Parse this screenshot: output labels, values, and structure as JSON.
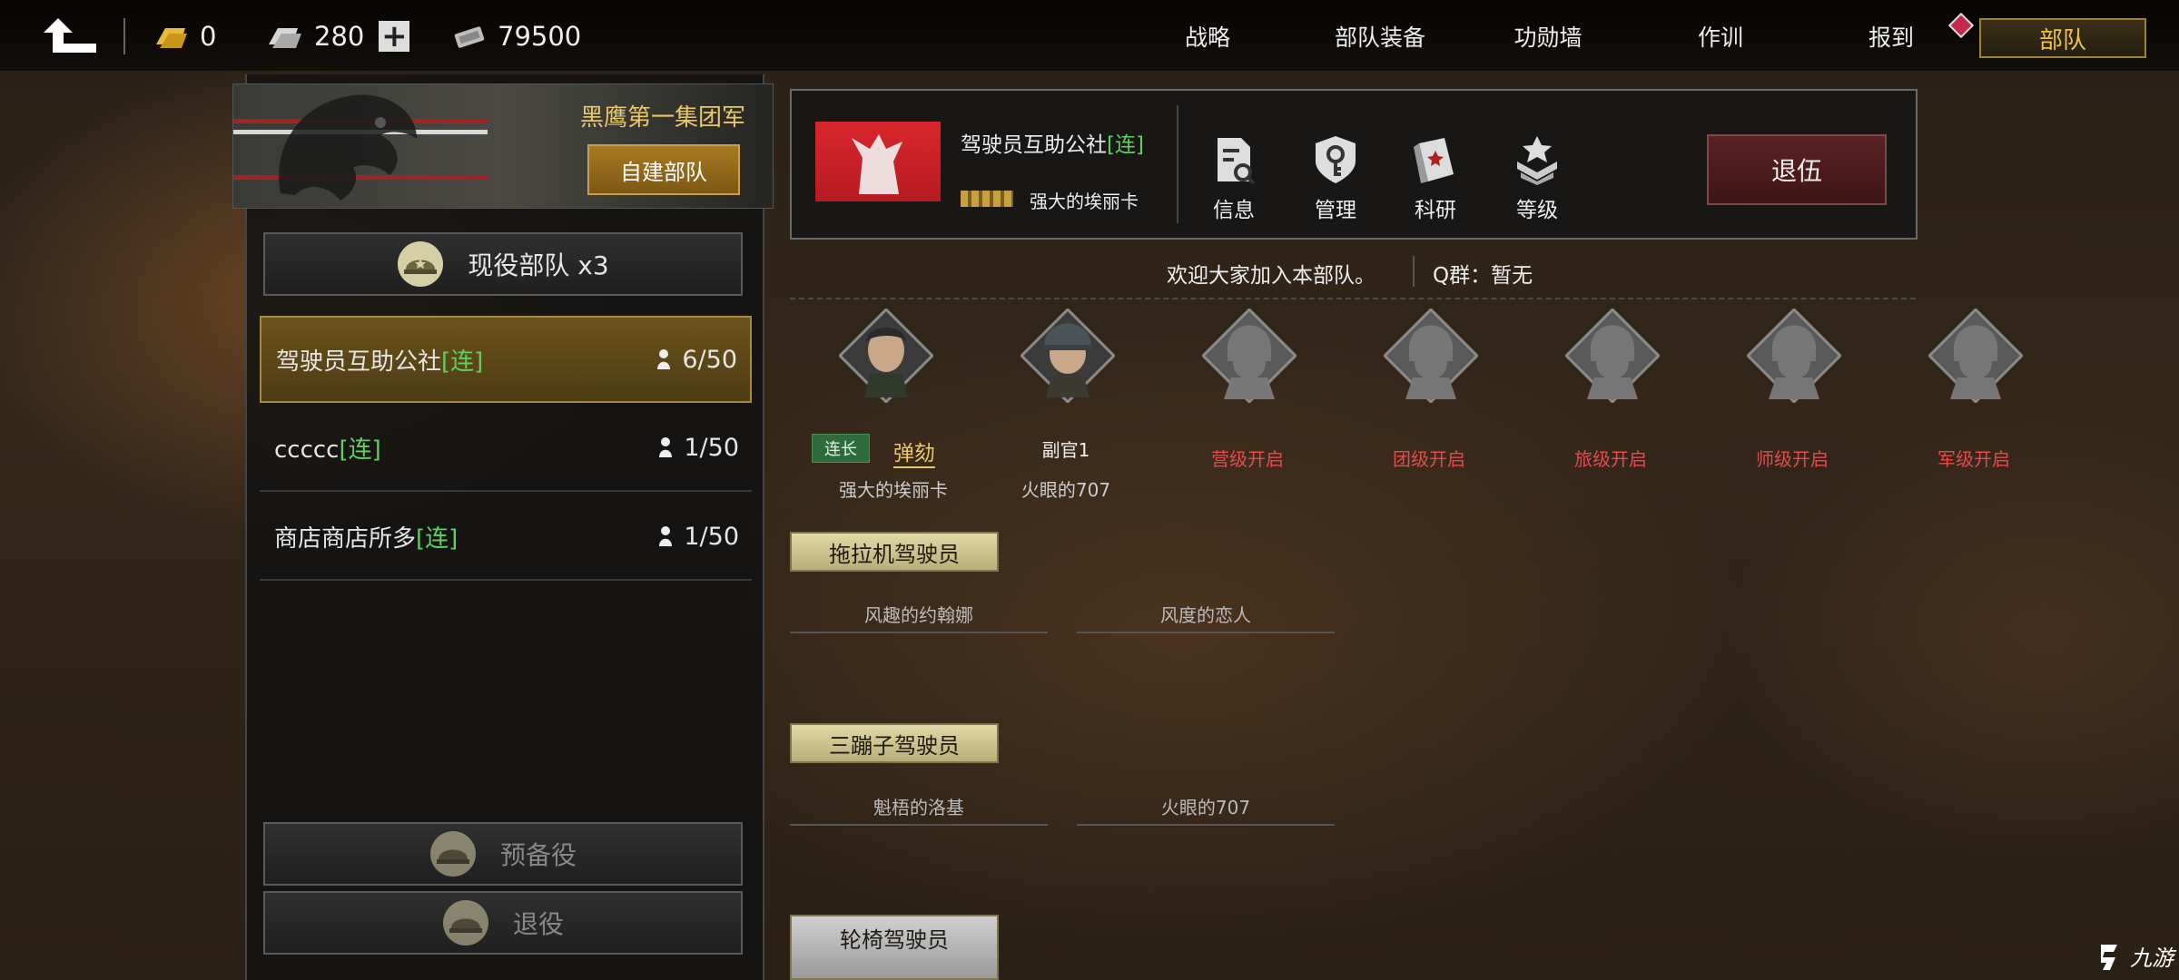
{
  "topbar": {
    "gold": "0",
    "silver": "280",
    "plus_label": "+",
    "cash": "79500",
    "nav": [
      "战略",
      "部队装备",
      "功勋墙",
      "作训",
      "报到"
    ],
    "active_tab": "部队"
  },
  "left": {
    "group_name": "黑鹰第一集团军",
    "create_label": "自建部队",
    "active_label": "现役部队 x3",
    "units": [
      {
        "name": "驾驶员互助公社",
        "tag": "[连]",
        "count": "6/50"
      },
      {
        "name": "ccccc",
        "tag": "[连]",
        "count": "1/50"
      },
      {
        "name": "商店商店所多",
        "tag": "[连]",
        "count": "1/50"
      }
    ],
    "reserve_label": "预备役",
    "retired_label": "退役"
  },
  "unit_info": {
    "name": "驾驶员互助公社",
    "tag": "[连]",
    "leader": "强大的埃丽卡",
    "functions": [
      "信息",
      "管理",
      "科研",
      "等级"
    ],
    "quit_label": "退伍",
    "welcome": "欢迎大家加入本部队。",
    "qgroup": "Q群：暂无"
  },
  "officers": [
    {
      "badge": "连长",
      "action": "弹劾",
      "name": "强大的埃丽卡"
    },
    {
      "title": "副官1",
      "name": "火眼的707"
    }
  ],
  "locked": [
    "营级开启",
    "团级开启",
    "旅级开启",
    "师级开启",
    "军级开启"
  ],
  "sections": [
    {
      "title": "拖拉机驾驶员",
      "members": [
        "风趣的约翰娜",
        "风度的恋人"
      ]
    },
    {
      "title": "三蹦子驾驶员",
      "members": [
        "魁梧的洛基",
        "火眼的707"
      ]
    },
    {
      "title": "轮椅驾驶员"
    }
  ],
  "watermark": "九游",
  "colors": {
    "accent_gold": "#f0c14a",
    "tag_green": "#5fd15f",
    "locked_red": "#e84a4a"
  }
}
